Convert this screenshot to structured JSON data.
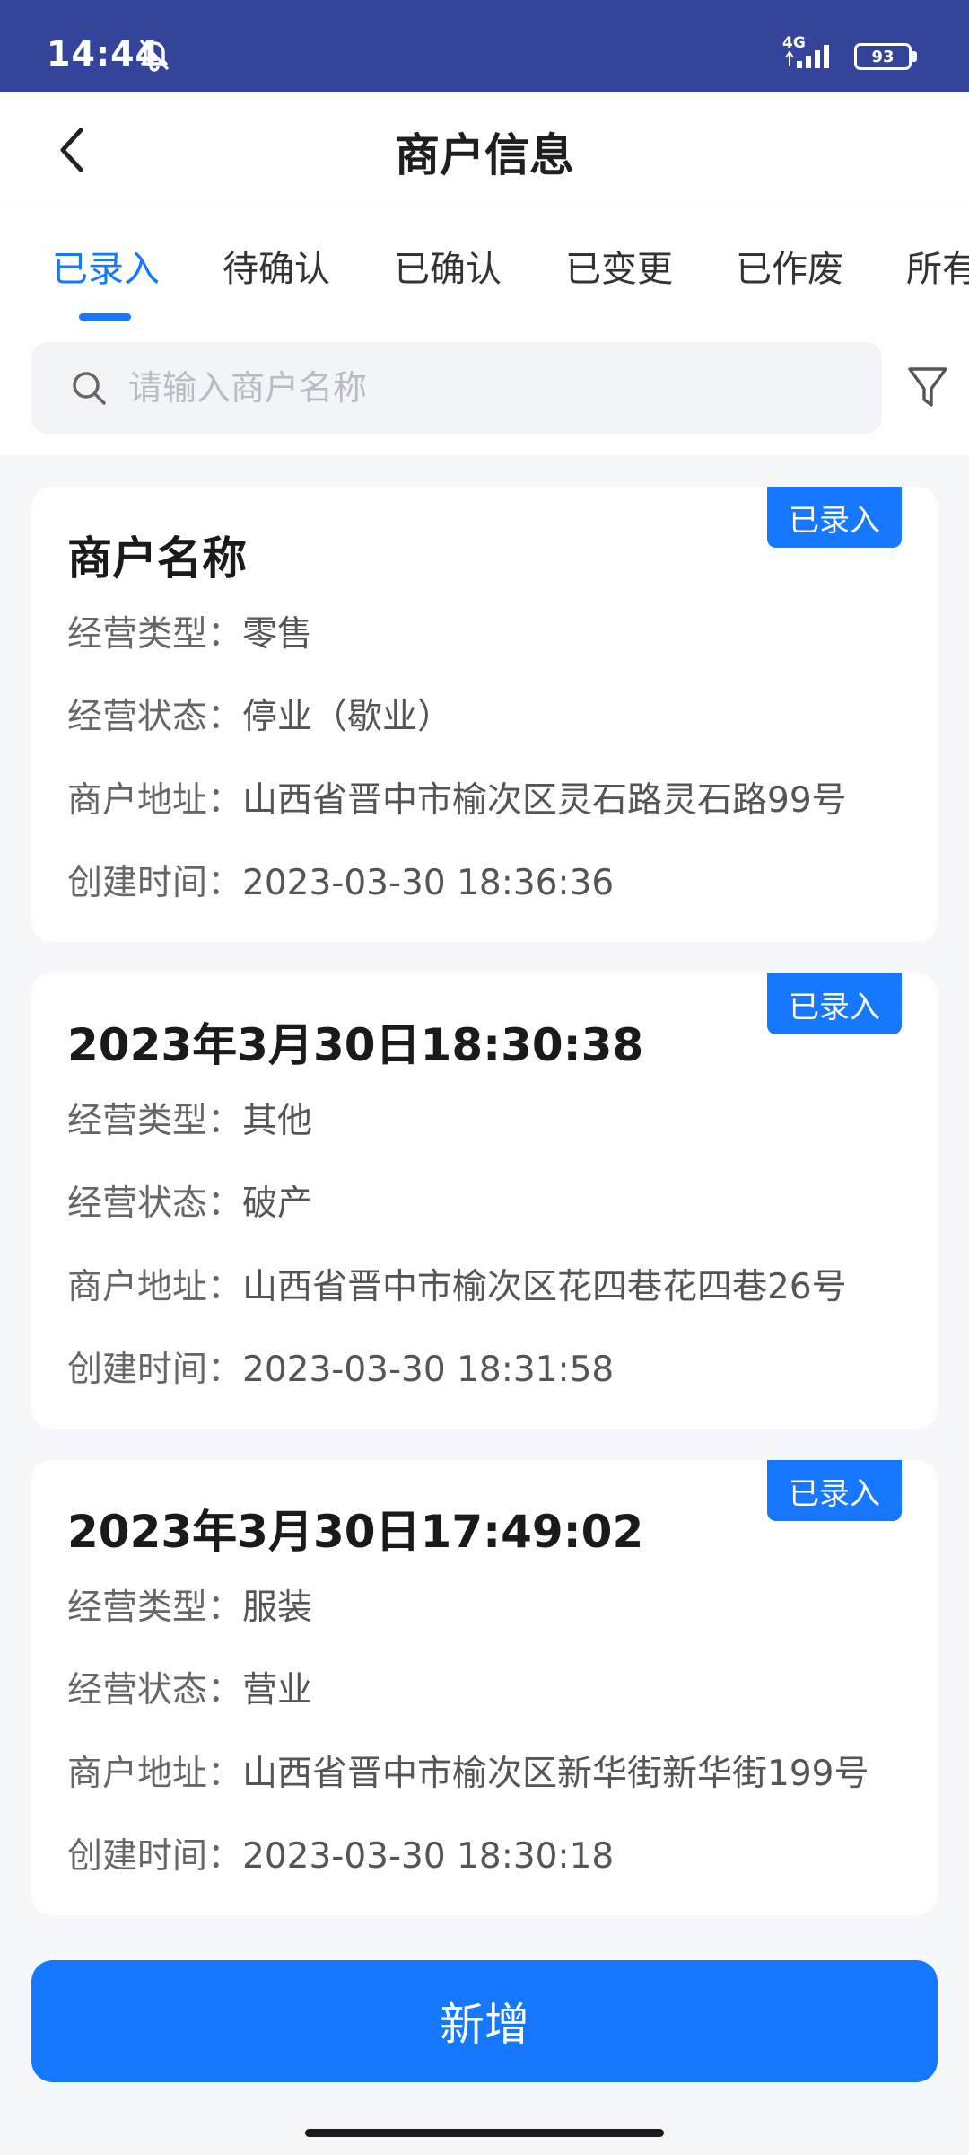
{
  "status_bar": {
    "time": "14:44",
    "network": "4G",
    "battery": "93"
  },
  "header": {
    "title": "商户信息"
  },
  "tabs": [
    {
      "label": "已录入",
      "active": true
    },
    {
      "label": "待确认"
    },
    {
      "label": "已确认"
    },
    {
      "label": "已变更"
    },
    {
      "label": "已作废"
    },
    {
      "label": "所有"
    }
  ],
  "search": {
    "placeholder": "请输入商户名称",
    "value": ""
  },
  "labels": {
    "business_type": "经营类型：",
    "business_status": "经营状态：",
    "address": "商户地址：",
    "created_at": "创建时间："
  },
  "merchants": [
    {
      "name": "商户名称",
      "status_badge": "已录入",
      "business_type": "零售",
      "business_status": "停业（歇业）",
      "address": "山西省晋中市榆次区灵石路灵石路99号",
      "created_at": "2023-03-30 18:36:36"
    },
    {
      "name": "2023年3月30日18:30:38",
      "status_badge": "已录入",
      "business_type": "其他",
      "business_status": "破产",
      "address": "山西省晋中市榆次区花四巷花四巷26号",
      "created_at": "2023-03-30 18:31:58"
    },
    {
      "name": "2023年3月30日17:49:02",
      "status_badge": "已录入",
      "business_type": "服装",
      "business_status": "营业",
      "address": "山西省晋中市榆次区新华街新华街199号",
      "created_at": "2023-03-30 18:30:18"
    }
  ],
  "add_button": {
    "label": "新增"
  },
  "colors": {
    "accent": "#1677ff",
    "status_bar": "#34449a"
  }
}
